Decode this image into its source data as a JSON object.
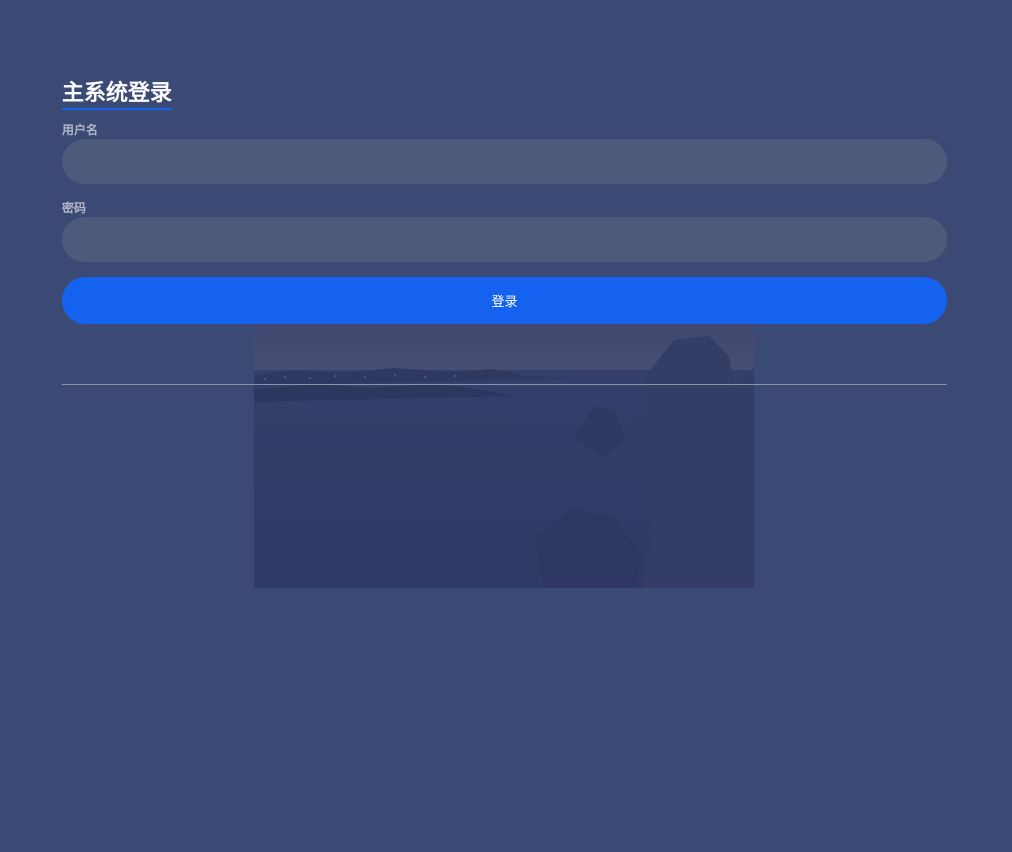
{
  "login": {
    "title": "主系统登录",
    "username_label": "用户名",
    "username_value": "",
    "password_label": "密码",
    "password_value": "",
    "submit_label": "登录"
  },
  "colors": {
    "background": "#3a4a74",
    "input_background": "#4c5a7c",
    "primary_button": "#1462ef",
    "title_underline": "#1463f0"
  }
}
